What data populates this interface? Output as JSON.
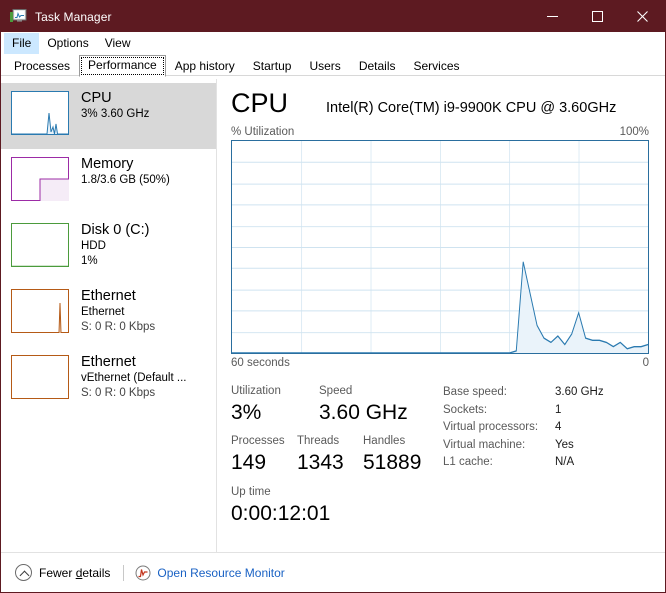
{
  "window": {
    "title": "Task Manager",
    "icon": "task-manager-icon",
    "accent_titlebar": "#5d1a21",
    "controls": {
      "minimize": "minimize-icon",
      "maximize": "maximize-icon",
      "close": "close-icon"
    }
  },
  "menu": {
    "items": [
      {
        "label": "File",
        "active": true
      },
      {
        "label": "Options",
        "active": false
      },
      {
        "label": "View",
        "active": false
      }
    ]
  },
  "tabs": [
    {
      "label": "Processes",
      "selected": false
    },
    {
      "label": "Performance",
      "selected": true
    },
    {
      "label": "App history",
      "selected": false
    },
    {
      "label": "Startup",
      "selected": false
    },
    {
      "label": "Users",
      "selected": false
    },
    {
      "label": "Details",
      "selected": false
    },
    {
      "label": "Services",
      "selected": false
    }
  ],
  "sidebar": {
    "items": [
      {
        "name": "cpu",
        "title": "CPU",
        "sub1": "3%  3.60 GHz",
        "sub2": "",
        "sub3": "",
        "selected": true,
        "color": "#2a7ab0",
        "thumb": "spike-graph"
      },
      {
        "name": "memory",
        "title": "Memory",
        "sub1": "1.8/3.6 GB (50%)",
        "sub2": "",
        "sub3": "",
        "selected": false,
        "color": "#9c2ba6",
        "thumb": "fill-block"
      },
      {
        "name": "disk",
        "title": "Disk 0 (C:)",
        "sub1": "HDD",
        "sub2": "1%",
        "sub3": "",
        "selected": false,
        "color": "#4b9b3c",
        "thumb": "flat-graph"
      },
      {
        "name": "ethernet-1",
        "title": "Ethernet",
        "sub1": "Ethernet",
        "sub2": "S: 0 R: 0 Kbps",
        "sub3": "",
        "selected": false,
        "color": "#b55a16",
        "thumb": "thin-spike-graph"
      },
      {
        "name": "ethernet-2",
        "title": "Ethernet",
        "sub1": "vEthernet (Default ...",
        "sub2": "S: 0 R: 0 Kbps",
        "sub3": "",
        "selected": false,
        "color": "#b55a16",
        "thumb": "empty-graph"
      }
    ]
  },
  "pane": {
    "heading": "CPU",
    "model": "Intel(R) Core(TM) i9-9900K CPU @ 3.60GHz",
    "graph_label_left": "% Utilization",
    "graph_label_right": "100%",
    "graph_foot_left": "60 seconds",
    "graph_foot_right": "0",
    "stats": {
      "utilization_label": "Utilization",
      "utilization_value": "3%",
      "speed_label": "Speed",
      "speed_value": "3.60 GHz",
      "processes_label": "Processes",
      "processes_value": "149",
      "threads_label": "Threads",
      "threads_value": "1343",
      "handles_label": "Handles",
      "handles_value": "51889",
      "uptime_label": "Up time",
      "uptime_value": "0:00:12:01"
    },
    "info": [
      {
        "label": "Base speed:",
        "value": "3.60 GHz"
      },
      {
        "label": "Sockets:",
        "value": "1"
      },
      {
        "label": "Virtual processors:",
        "value": "4"
      },
      {
        "label": "Virtual machine:",
        "value": "Yes"
      },
      {
        "label": "L1 cache:",
        "value": "N/A"
      }
    ]
  },
  "chart_data": {
    "type": "area",
    "title": "CPU % Utilization",
    "xlabel": "60 seconds",
    "ylabel": "% Utilization",
    "ylim": [
      0,
      100
    ],
    "xlim": [
      60,
      0
    ],
    "grid": true,
    "grid_cols": 6,
    "grid_rows": 10,
    "line_color": "#2a7ab0",
    "fill_color": "#eaf3fa",
    "legend": "none",
    "x": [
      60,
      59,
      58,
      57,
      56,
      55,
      54,
      53,
      52,
      51,
      50,
      49,
      48,
      47,
      46,
      45,
      44,
      43,
      42,
      41,
      40,
      39,
      38,
      37,
      36,
      35,
      34,
      33,
      32,
      31,
      30,
      29,
      28,
      27,
      26,
      25,
      24,
      23,
      22,
      21,
      20,
      19,
      18,
      17,
      16,
      15,
      14,
      13,
      12,
      11,
      10,
      9,
      8,
      7,
      6,
      5,
      4,
      3,
      2,
      1,
      0
    ],
    "values": [
      0,
      0,
      0,
      0,
      0,
      0,
      0,
      0,
      0,
      0,
      0,
      0,
      0,
      0,
      0,
      0,
      0,
      0,
      0,
      0,
      0,
      0,
      0,
      0,
      0,
      0,
      0,
      0,
      0,
      0,
      0,
      0,
      0,
      0,
      0,
      0,
      0,
      0,
      0,
      0,
      0,
      1,
      43,
      28,
      13,
      7,
      5,
      8,
      4,
      9,
      19,
      7,
      6,
      6,
      5,
      3,
      5,
      2,
      3,
      3,
      4
    ]
  },
  "footer": {
    "fewer_details_pre": "Fewer ",
    "fewer_details_accel": "d",
    "fewer_details_post": "etails",
    "fewer_icon": "chevron-up-circle-icon",
    "resource_monitor_label": "Open Resource Monitor",
    "resource_monitor_icon": "resource-monitor-icon",
    "link_color": "#1a62c4"
  }
}
